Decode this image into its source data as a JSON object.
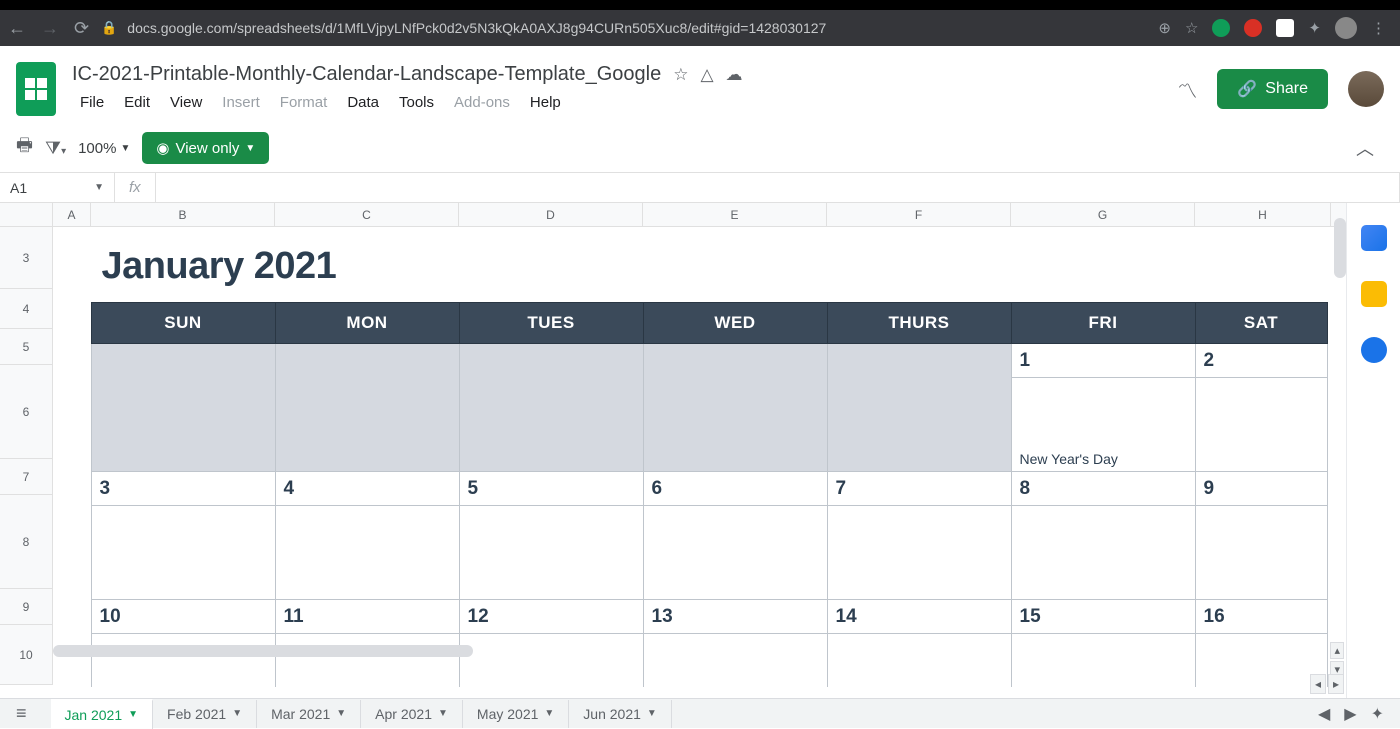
{
  "browser": {
    "url": "docs.google.com/spreadsheets/d/1MfLVjpyLNfPck0d2v5N3kQkA0AXJ8g94CURn505Xuc8/edit#gid=1428030127"
  },
  "doc": {
    "title": "IC-2021-Printable-Monthly-Calendar-Landscape-Template_Google"
  },
  "menus": {
    "file": "File",
    "edit": "Edit",
    "view": "View",
    "insert": "Insert",
    "format": "Format",
    "data": "Data",
    "tools": "Tools",
    "addons": "Add-ons",
    "help": "Help"
  },
  "header": {
    "share": "Share"
  },
  "toolbar": {
    "zoom": "100%",
    "view_only": "View only"
  },
  "namebox": {
    "ref": "A1"
  },
  "columns": {
    "A": "A",
    "B": "B",
    "C": "C",
    "D": "D",
    "E": "E",
    "F": "F",
    "G": "G",
    "H": "H"
  },
  "rows": {
    "r3": "3",
    "r4": "4",
    "r5": "5",
    "r6": "6",
    "r7": "7",
    "r8": "8",
    "r9": "9",
    "r10": "10"
  },
  "calendar": {
    "title": "January 2021",
    "headers": {
      "sun": "SUN",
      "mon": "MON",
      "tues": "TUES",
      "wed": "WED",
      "thurs": "THURS",
      "fri": "FRI",
      "sat": "SAT"
    },
    "w1": {
      "d1": "1",
      "d2": "2",
      "event1": "New Year's Day"
    },
    "w2": {
      "d3": "3",
      "d4": "4",
      "d5": "5",
      "d6": "6",
      "d7": "7",
      "d8": "8",
      "d9": "9"
    },
    "w3": {
      "d10": "10",
      "d11": "11",
      "d12": "12",
      "d13": "13",
      "d14": "14",
      "d15": "15",
      "d16": "16"
    }
  },
  "tabs": {
    "t0": "Jan 2021",
    "t1": "Feb 2021",
    "t2": "Mar 2021",
    "t3": "Apr 2021",
    "t4": "May 2021",
    "t5": "Jun 2021"
  }
}
